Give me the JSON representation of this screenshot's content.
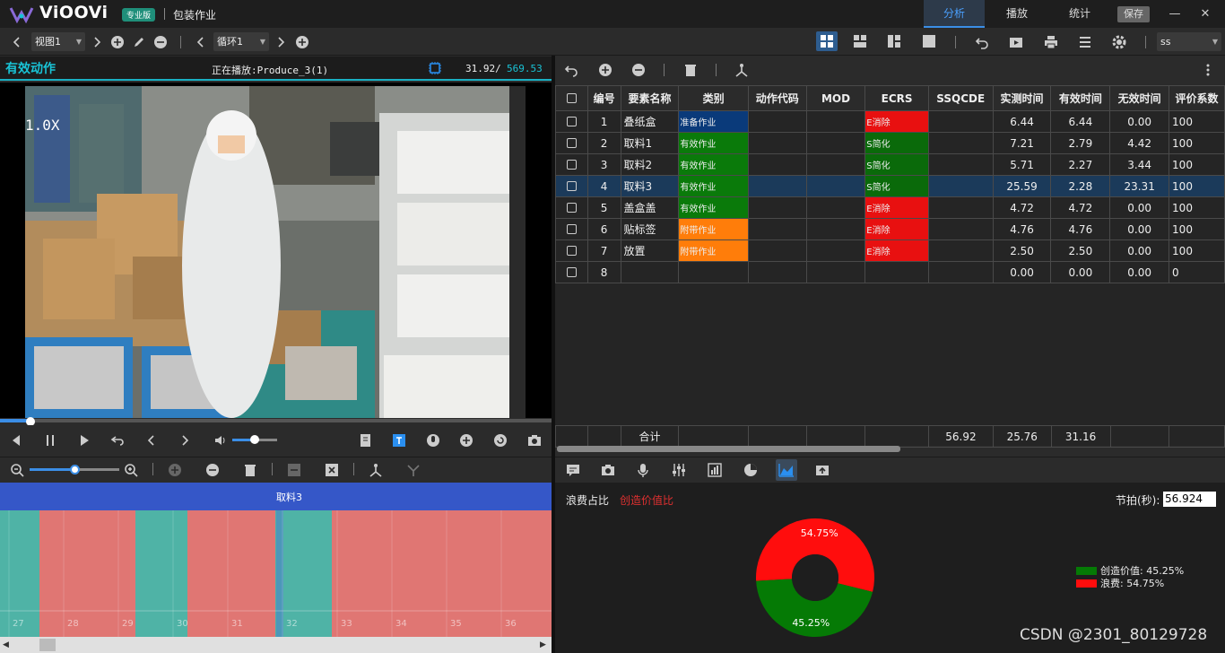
{
  "app": {
    "logo": "ViOOVi",
    "edition": "专业版",
    "document_title": "包装作业",
    "tabs": [
      "分析",
      "播放",
      "统计"
    ],
    "save_label": "保存",
    "minimize": "—",
    "close": "✕"
  },
  "toolbar": {
    "view_select": "视图1",
    "cycle_select": "循环1",
    "user_select": "ss"
  },
  "video": {
    "panel_title": "有效动作",
    "now_playing": "正在播放:Produce_3(1)",
    "current_time": "31.92/",
    "total_time": "569.53",
    "speed": "1.0X",
    "progress_fraction": 0.056,
    "volume_fraction": 0.5
  },
  "timeline": {
    "current_element": "取料3",
    "zoom_fraction": 0.5,
    "ticks": [
      "27",
      "28",
      "29",
      "30",
      "31",
      "32",
      "33",
      "34",
      "35",
      "36"
    ],
    "blocks": [
      {
        "type": "valid"
      },
      {
        "type": "waste"
      },
      {
        "type": "valid"
      },
      {
        "type": "waste"
      },
      {
        "type": "valid"
      },
      {
        "type": "waste"
      }
    ]
  },
  "table": {
    "headers": [
      "编号",
      "要素名称",
      "类别",
      "动作代码",
      "MOD",
      "ECRS",
      "SSQCDE",
      "实测时间",
      "有效时间",
      "无效时间",
      "评价系数"
    ],
    "rows": [
      {
        "no": "1",
        "name": "叠纸盒",
        "category": "准备作业",
        "cat_color": "#0a3a7a",
        "ecrs": "E消除",
        "ecrs_color": "#e81010",
        "measured": "6.44",
        "valid": "6.44",
        "invalid": "0.00",
        "rating": "100"
      },
      {
        "no": "2",
        "name": "取料1",
        "category": "有效作业",
        "cat_color": "#0a7a0a",
        "ecrs": "S简化",
        "ecrs_color": "#0a6a0a",
        "measured": "7.21",
        "valid": "2.79",
        "invalid": "4.42",
        "rating": "100"
      },
      {
        "no": "3",
        "name": "取料2",
        "category": "有效作业",
        "cat_color": "#0a7a0a",
        "ecrs": "S简化",
        "ecrs_color": "#0a6a0a",
        "measured": "5.71",
        "valid": "2.27",
        "invalid": "3.44",
        "rating": "100"
      },
      {
        "no": "4",
        "name": "取料3",
        "category": "有效作业",
        "cat_color": "#0a7a0a",
        "ecrs": "S简化",
        "ecrs_color": "#0a6a0a",
        "measured": "25.59",
        "valid": "2.28",
        "invalid": "23.31",
        "rating": "100",
        "selected": true
      },
      {
        "no": "5",
        "name": "盖盒盖",
        "category": "有效作业",
        "cat_color": "#0a7a0a",
        "ecrs": "E消除",
        "ecrs_color": "#e81010",
        "measured": "4.72",
        "valid": "4.72",
        "invalid": "0.00",
        "rating": "100"
      },
      {
        "no": "6",
        "name": "贴标签",
        "category": "附带作业",
        "cat_color": "#ff7d0a",
        "ecrs": "E消除",
        "ecrs_color": "#e81010",
        "measured": "4.76",
        "valid": "4.76",
        "invalid": "0.00",
        "rating": "100"
      },
      {
        "no": "7",
        "name": "放置",
        "category": "附带作业",
        "cat_color": "#ff7d0a",
        "ecrs": "E消除",
        "ecrs_color": "#e81010",
        "measured": "2.50",
        "valid": "2.50",
        "invalid": "0.00",
        "rating": "100"
      },
      {
        "no": "8",
        "name": "",
        "category": "",
        "cat_color": "",
        "ecrs": "",
        "ecrs_color": "",
        "measured": "0.00",
        "valid": "0.00",
        "invalid": "0.00",
        "rating": "0"
      }
    ],
    "total_label": "合计",
    "total_measured": "56.92",
    "total_valid": "25.76",
    "total_invalid": "31.16"
  },
  "chart_panel": {
    "tab_waste": "浪费占比",
    "tab_value": "创造价值比",
    "takt_label": "节拍(秒):",
    "takt_value": "56.924"
  },
  "chart_data": {
    "type": "pie",
    "donut": true,
    "slices": [
      {
        "label": "浪费",
        "value": 54.75,
        "color": "#ff0d0d",
        "data_label": "54.75%"
      },
      {
        "label": "创造价值",
        "value": 45.25,
        "color": "#057a05",
        "data_label": "45.25%"
      }
    ],
    "legend": [
      "创造价值: 45.25%",
      "浪费: 54.75%"
    ],
    "legend_position": "right"
  },
  "watermark": "CSDN @2301_80129728"
}
